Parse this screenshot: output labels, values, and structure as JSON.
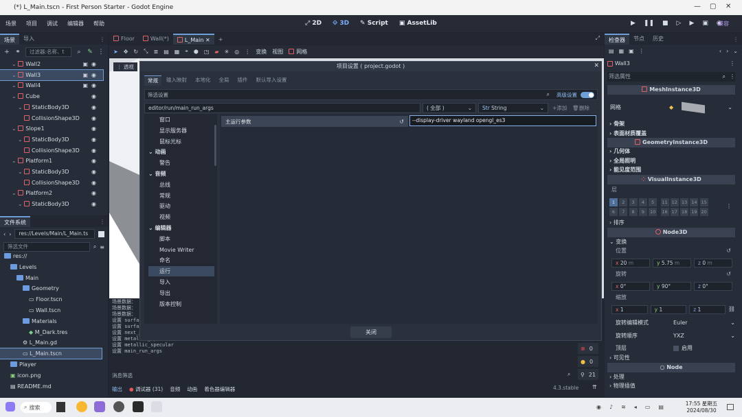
{
  "window": {
    "title": "(*) L_Main.tscn - First Person Starter - Godot Engine"
  },
  "menu": {
    "items": [
      "场景",
      "项目",
      "调试",
      "编辑器",
      "帮助"
    ]
  },
  "main_screens": [
    "2D",
    "3D",
    "Script",
    "AssetLib"
  ],
  "renderer": "兼容",
  "scene_dock": {
    "tabs": [
      "场景",
      "导入"
    ],
    "filter_placeholder": "过滤器:名称、t",
    "nodes": [
      {
        "label": "Wall2",
        "indent": 1,
        "icon": "mesh"
      },
      {
        "label": "Wall3",
        "indent": 1,
        "icon": "mesh",
        "selected": true
      },
      {
        "label": "Wall4",
        "indent": 1,
        "icon": "mesh"
      },
      {
        "label": "Cube",
        "indent": 1,
        "icon": "mesh"
      },
      {
        "label": "StaticBody3D",
        "indent": 2,
        "icon": "body"
      },
      {
        "label": "CollisionShape3D",
        "indent": 3,
        "icon": "shape"
      },
      {
        "label": "Slope1",
        "indent": 1,
        "icon": "mesh"
      },
      {
        "label": "StaticBody3D",
        "indent": 2,
        "icon": "body"
      },
      {
        "label": "CollisionShape3D",
        "indent": 3,
        "icon": "shape"
      },
      {
        "label": "Platform1",
        "indent": 1,
        "icon": "mesh"
      },
      {
        "label": "StaticBody3D",
        "indent": 2,
        "icon": "body"
      },
      {
        "label": "CollisionShape3D",
        "indent": 3,
        "icon": "shape"
      },
      {
        "label": "Platform2",
        "indent": 1,
        "icon": "mesh"
      },
      {
        "label": "StaticBody3D",
        "indent": 2,
        "icon": "body"
      }
    ]
  },
  "filesystem": {
    "tab": "文件系统",
    "path": "res://Levels/Main/L_Main.ts",
    "filter_placeholder": "筛选文件",
    "items": [
      {
        "label": "res://",
        "indent": 0,
        "kind": "folder"
      },
      {
        "label": "Levels",
        "indent": 1,
        "kind": "folder"
      },
      {
        "label": "Main",
        "indent": 2,
        "kind": "folder"
      },
      {
        "label": "Geometry",
        "indent": 3,
        "kind": "folder"
      },
      {
        "label": "Floor.tscn",
        "indent": 4,
        "kind": "scene"
      },
      {
        "label": "Wall.tscn",
        "indent": 4,
        "kind": "scene"
      },
      {
        "label": "Materials",
        "indent": 3,
        "kind": "folder"
      },
      {
        "label": "M_Dark.tres",
        "indent": 4,
        "kind": "res"
      },
      {
        "label": "L_Main.gd",
        "indent": 3,
        "kind": "gear"
      },
      {
        "label": "L_Main.tscn",
        "indent": 3,
        "kind": "scene",
        "selected": true
      },
      {
        "label": "Player",
        "indent": 1,
        "kind": "folder"
      },
      {
        "label": "icon.png",
        "indent": 1,
        "kind": "image"
      },
      {
        "label": "README.md",
        "indent": 1,
        "kind": "doc"
      }
    ]
  },
  "editor_tabs": [
    "Floor",
    "Wall(*)",
    "L_Main"
  ],
  "viewport_toolbar": {
    "transform": "变换",
    "view": "视图",
    "mesh": "网格",
    "perspective": "透视"
  },
  "dialog": {
    "title": "项目设置 ( project.godot )",
    "tabs": [
      "常规",
      "输入映射",
      "本地化",
      "全局",
      "插件",
      "默认导入设置"
    ],
    "filter_placeholder": "筛选设置",
    "advanced_label": "高级设置",
    "property_path": "editor/run/main_run_args",
    "type_all": "( 全部 )",
    "type_value": "String",
    "add_label": "添加",
    "delete_label": "删除",
    "sections": [
      {
        "label": "窗口",
        "level": 1
      },
      {
        "label": "显示服务器",
        "level": 1
      },
      {
        "label": "鼠标光标",
        "level": 1
      },
      {
        "label": "动画",
        "level": 0
      },
      {
        "label": "警告",
        "level": 1
      },
      {
        "label": "音频",
        "level": 0
      },
      {
        "label": "总线",
        "level": 1
      },
      {
        "label": "常规",
        "level": 1
      },
      {
        "label": "驱动",
        "level": 1
      },
      {
        "label": "视频",
        "level": 1
      },
      {
        "label": "编辑器",
        "level": 0
      },
      {
        "label": "脚本",
        "level": 1
      },
      {
        "label": "Movie Writer",
        "level": 1
      },
      {
        "label": "命名",
        "level": 1
      },
      {
        "label": "运行",
        "level": 1,
        "selected": true
      },
      {
        "label": "导入",
        "level": 1
      },
      {
        "label": "导出",
        "level": 1
      },
      {
        "label": "版本控制",
        "level": 1
      }
    ],
    "setting_label": "主运行参数",
    "setting_value": "--display-driver wayland opengl_es3",
    "close_label": "关闭"
  },
  "output": {
    "lines": [
      "场景数据：",
      "场景数据：",
      "场景数据：",
      "设置 surfa",
      "设置 surfa",
      "设置 next_pass",
      "设置 metallic_specular",
      "设置 metallic_specular",
      "设置 main_run_args"
    ],
    "filter_label": "消息筛选",
    "error_count": "0",
    "warning_count": "0",
    "message_count": "21",
    "bottom_tabs": [
      "输出",
      "调试器 (31)",
      "音频",
      "动画",
      "着色器编辑器"
    ],
    "version": "4.3.stable"
  },
  "inspector": {
    "tabs": [
      "检查器",
      "节点",
      "历史"
    ],
    "node_name": "Wall3",
    "filter_placeholder": "筛选属性",
    "class_mesh": "MeshInstance3D",
    "mesh_label": "网格",
    "sections1": [
      "骨架",
      "表面材质覆盖"
    ],
    "class_geom": "GeometryInstance3D",
    "sections2": [
      "几何体",
      "全局照明",
      "能见度范围"
    ],
    "class_visual": "VisualInstance3D",
    "layers_label": "层",
    "layers_top": [
      "1",
      "2",
      "3",
      "4",
      "5",
      "11",
      "12",
      "13",
      "14",
      "15"
    ],
    "layers_bottom": [
      "6",
      "7",
      "8",
      "9",
      "10",
      "16",
      "17",
      "18",
      "19",
      "20"
    ],
    "sort_label": "排序",
    "class_node3d": "Node3D",
    "transform_label": "变换",
    "position_label": "位置",
    "position": {
      "x": "20",
      "y": "5.75",
      "z": "0",
      "unit": "m"
    },
    "rotation_label": "旋转",
    "rotation": {
      "x": "0°",
      "y": "90°",
      "z": "0°"
    },
    "scale_label": "缩放",
    "scale": {
      "x": "1",
      "y": "1",
      "z": "1"
    },
    "rot_edit_label": "旋转编辑模式",
    "rot_edit_value": "Euler",
    "rot_order_label": "旋转顺序",
    "rot_order_value": "YXZ",
    "top_level_label": "顶层",
    "top_level_value": "启用",
    "visibility_label": "可见性",
    "class_node": "Node",
    "process_label": "处理",
    "physics_label": "物理插值"
  },
  "taskbar": {
    "search": "搜索",
    "time": "17:55 星期五",
    "date": "2024/08/30"
  },
  "colors": {
    "accent": "#6e9fd6",
    "node_red": "#e0646a",
    "bg": "#202531"
  }
}
